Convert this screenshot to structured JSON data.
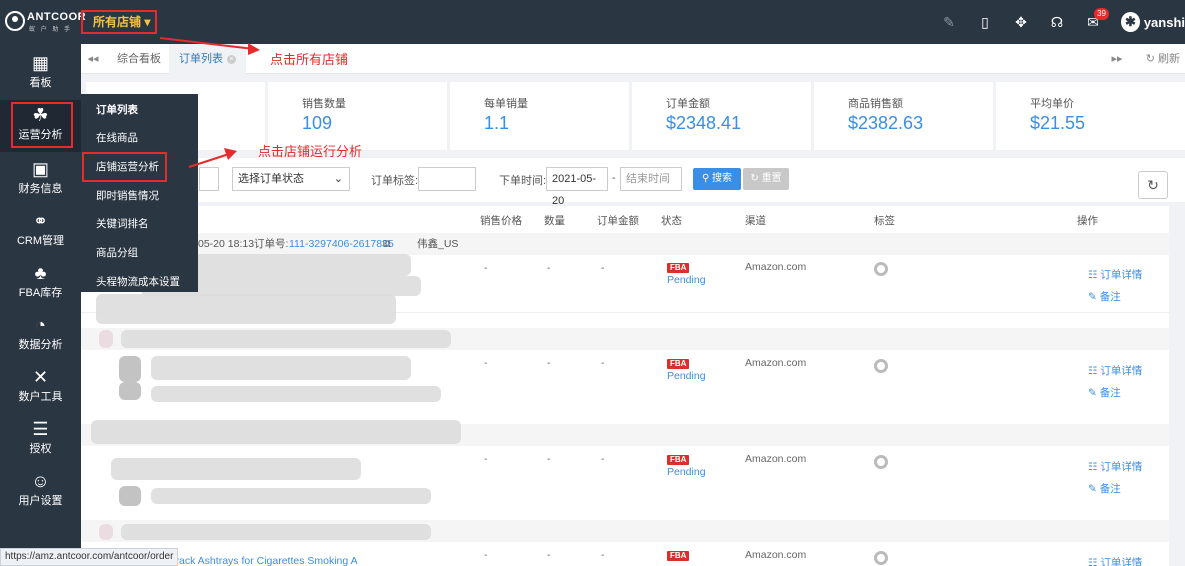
{
  "app": {
    "logo": "ANTCOOR",
    "logo_sub": "蚁 户 助 手",
    "store_selector": "所有店铺 ▾",
    "user": "yanshi",
    "mail_badge": "39"
  },
  "sidebar": {
    "items": [
      {
        "label": "看板",
        "icon": "dashboard-icon"
      },
      {
        "label": "运营分析",
        "icon": "operations-icon"
      },
      {
        "label": "财务信息",
        "icon": "finance-icon"
      },
      {
        "label": "CRM管理",
        "icon": "crm-icon"
      },
      {
        "label": "FBA库存",
        "icon": "fba-inventory-icon"
      },
      {
        "label": "数据分析",
        "icon": "pie-chart-icon"
      },
      {
        "label": "数户工具",
        "icon": "tools-icon"
      },
      {
        "label": "授权",
        "icon": "sliders-icon"
      },
      {
        "label": "用户设置",
        "icon": "user-icon"
      }
    ]
  },
  "submenu": {
    "items": [
      "订单列表",
      "在线商品",
      "店铺运营分析",
      "即时销售情况",
      "关键词排名",
      "商品分组",
      "头程物流成本设置"
    ]
  },
  "tabs": {
    "items": [
      "综合看板",
      "订单列表"
    ],
    "refresh": "刷新"
  },
  "annotations": {
    "store": "点击所有店铺",
    "analysis": "点击店铺运行分析"
  },
  "stats": [
    {
      "label": "销售数量",
      "value": "109"
    },
    {
      "label": "每单销量",
      "value": "1.1"
    },
    {
      "label": "订单金额",
      "value": "$2348.41"
    },
    {
      "label": "商品销售额",
      "value": "$2382.63"
    },
    {
      "label": "平均单价",
      "value": "$21.55"
    }
  ],
  "filters": {
    "status_select": "选择订单状态",
    "tag_label": "订单标签:",
    "time_label": "下单时间:",
    "start_date": "2021-05-20",
    "dash": "-",
    "end_placeholder": "结束时间",
    "search": "搜索",
    "reset": "重置"
  },
  "table": {
    "headers": [
      "销售价格",
      "数量",
      "订单金额",
      "状态",
      "渠道",
      "标签",
      "操作"
    ],
    "first_group": {
      "time": "05-20 18:13",
      "order_label": "订单号:",
      "order_no": "111-3297406-2617835",
      "store": "伟鑫_US"
    },
    "rows": [
      {
        "price": "-",
        "qty": "-",
        "amount": "-",
        "fba": "FBA",
        "status": "Pending",
        "channel": "Amazon.com",
        "detail": "订单详情",
        "note": "备注"
      },
      {
        "price": "-",
        "qty": "-",
        "amount": "-",
        "fba": "FBA",
        "status": "Pending",
        "channel": "Amazon.com",
        "detail": "订单详情",
        "note": "备注"
      },
      {
        "price": "-",
        "qty": "-",
        "amount": "-",
        "fba": "FBA",
        "status": "Pending",
        "channel": "Amazon.com",
        "detail": "订单详情",
        "note": "备注"
      },
      {
        "price": "-",
        "qty": "-",
        "amount": "-",
        "fba": "FBA",
        "status": "",
        "channel": "Amazon.com",
        "detail": "订单详情",
        "note": ""
      }
    ],
    "last_product": "Pack Ashtrays for Cigarettes Smoking A"
  },
  "status_url": "https://amz.antcoor.com/antcoor/order"
}
